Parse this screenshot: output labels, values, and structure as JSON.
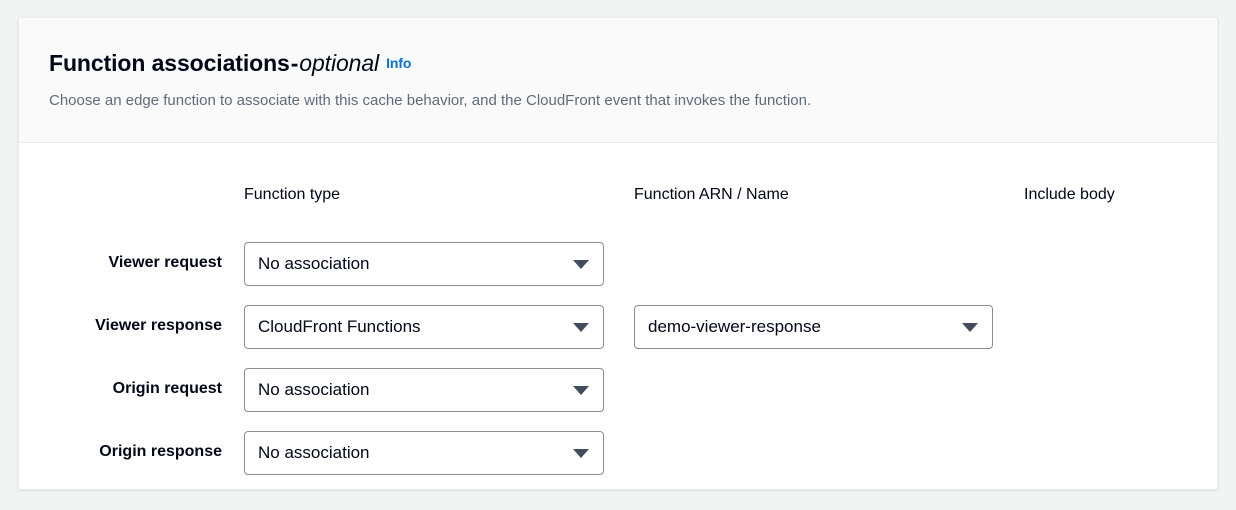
{
  "panel": {
    "title_main": "Function associations",
    "title_dash": "-",
    "title_optional": "optional",
    "info_label": "Info",
    "description": "Choose an edge function to associate with this cache behavior, and the CloudFront event that invokes the function.",
    "colors": {
      "page_background": "#f2f3f3",
      "panel_background": "#ffffff",
      "header_background": "#fafafa",
      "border": "#e9ebed",
      "link_blue": "#0972d3",
      "text_primary": "#000716",
      "text_secondary": "#5f6b7a",
      "select_border": "#8c8c94",
      "caret": "#414d5c"
    }
  },
  "columns": [
    {
      "label": "Function type"
    },
    {
      "label": "Function ARN / Name"
    },
    {
      "label": "Include body"
    }
  ],
  "rows": [
    {
      "label": "Viewer request",
      "function_type": "No association",
      "function_arn": null,
      "include_body": null
    },
    {
      "label": "Viewer response",
      "function_type": "CloudFront Functions",
      "function_arn": "demo-viewer-response",
      "include_body": null
    },
    {
      "label": "Origin request",
      "function_type": "No association",
      "function_arn": null,
      "include_body": null
    },
    {
      "label": "Origin response",
      "function_type": "No association",
      "function_arn": null,
      "include_body": null
    }
  ]
}
